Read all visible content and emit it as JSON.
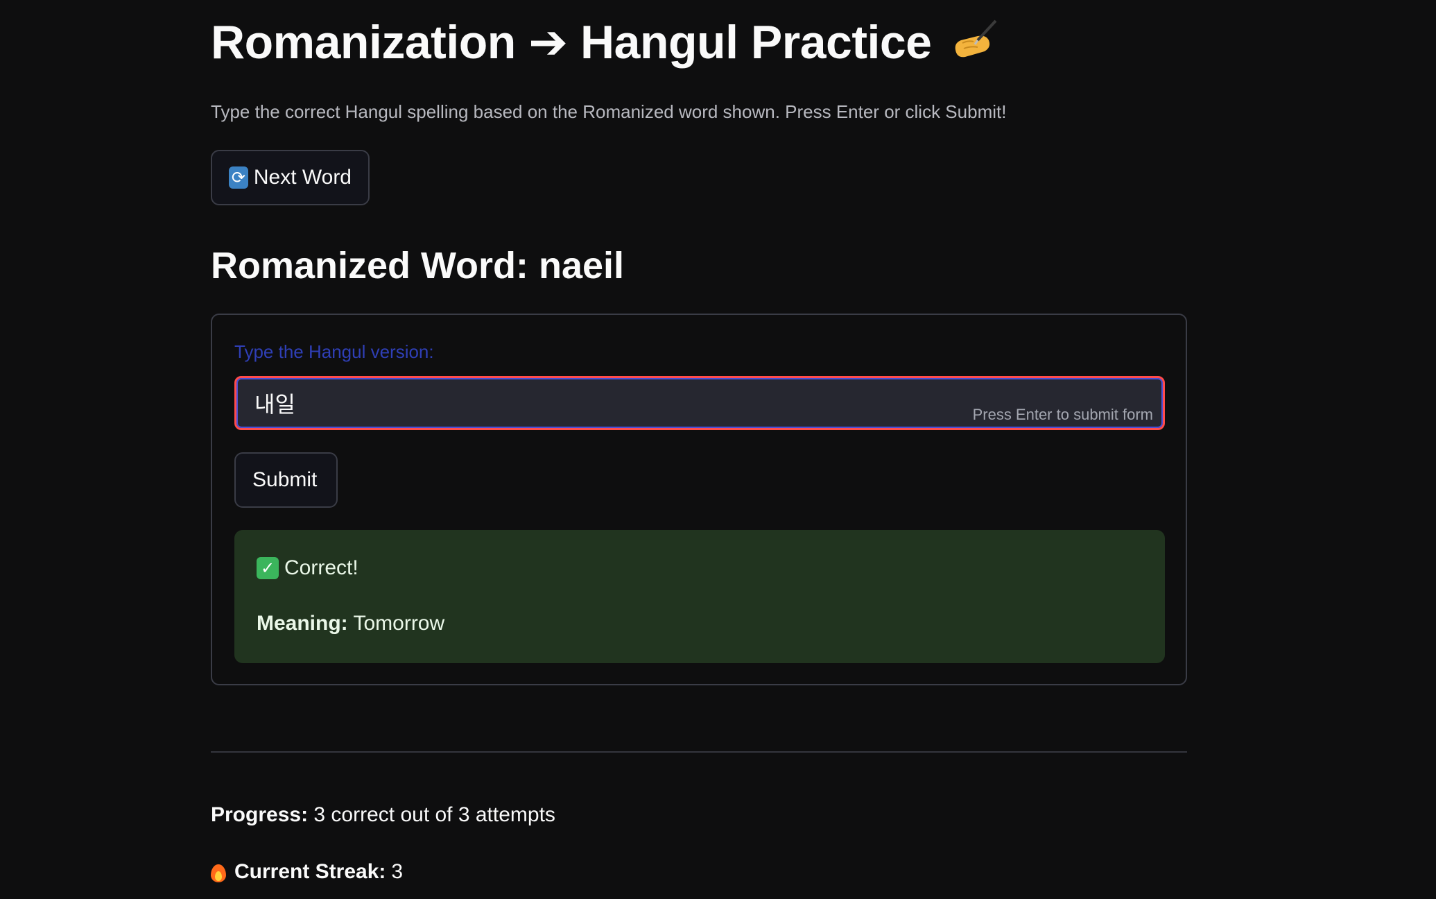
{
  "header": {
    "title": "Romanization ➔ Hangul Practice",
    "title_icon": "writing-hand-icon",
    "subtitle": "Type the correct Hangul spelling based on the Romanized word shown. Press Enter or click Submit!"
  },
  "controls": {
    "next_word_icon": "refresh-icon",
    "next_word_label": "Next Word"
  },
  "word": {
    "heading": "Romanized Word: naeil"
  },
  "form": {
    "field_label": "Type the Hangul version:",
    "input_value": "내일",
    "input_hint": "Press Enter to submit form",
    "submit_label": "Submit"
  },
  "result": {
    "status_icon": "check-mark-icon",
    "status_text": "Correct!",
    "meaning_label": "Meaning:",
    "meaning_value": "Tomorrow"
  },
  "stats": {
    "progress_label": "Progress:",
    "progress_text": "3 correct out of 3 attempts",
    "streak_icon": "fire-icon",
    "streak_label": "Current Streak:",
    "streak_value": "3"
  },
  "colors": {
    "background": "#0e0e0f",
    "accent_red": "#ff4b4b",
    "label_blue": "#2f3fb6",
    "success_bg": "#21341f"
  }
}
